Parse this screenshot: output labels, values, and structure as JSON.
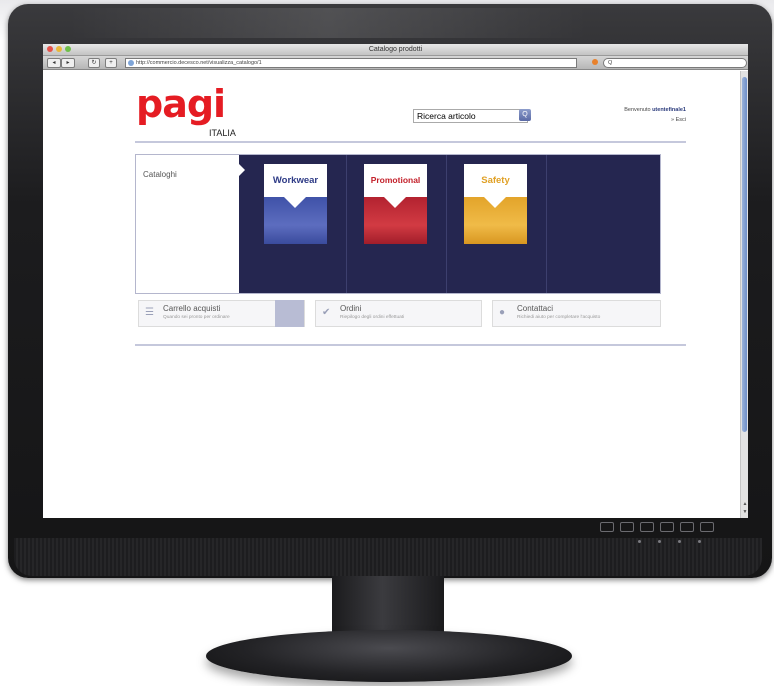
{
  "browser": {
    "window_title": "Catalogo prodotti",
    "url": "http://commercio.decesco.net/visualizza_catalogo/1",
    "nav_back": "◂",
    "nav_forward": "▸",
    "reload": "↻",
    "add": "+",
    "search_placeholder": "Q"
  },
  "header": {
    "logo_text": "pagi",
    "logo_subtitle": "ITALIA",
    "search_value": "Ricerca articolo",
    "search_button": "Q",
    "welcome_prefix": "Benvenuto ",
    "welcome_user": "utentefinale1",
    "exit_label": "» Esci"
  },
  "catalog": {
    "label": "Cataloghi",
    "cards": [
      {
        "title": "Workwear",
        "title_color": "#2e3b86",
        "body_color": "#3f52a8"
      },
      {
        "title": "Promotional",
        "title_color": "#c3202a",
        "body_color": "#b32230"
      },
      {
        "title": "Safety",
        "title_color": "#e0a127",
        "body_color": "#e3a42a"
      }
    ]
  },
  "actions": [
    {
      "title": "Carrello acquisti",
      "subtitle": "Quando sei pronto per ordinare",
      "icon": "cart-icon"
    },
    {
      "title": "Ordini",
      "subtitle": "Riepilogo degli ordini effettuati",
      "icon": "check-icon"
    },
    {
      "title": "Contattaci",
      "subtitle": "Richiedi aiuto per completare l'acquisto",
      "icon": "speech-bubble-icon"
    }
  ],
  "colors": {
    "brand_red": "#e51c23",
    "panel_navy": "#252650"
  }
}
